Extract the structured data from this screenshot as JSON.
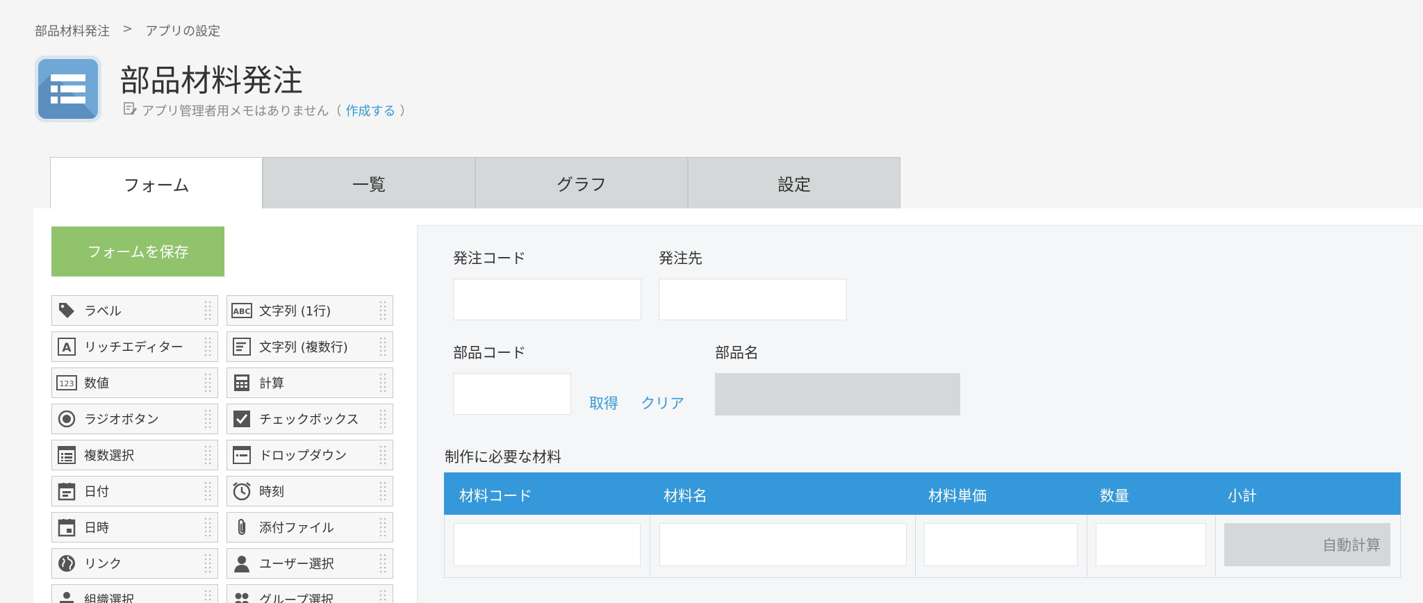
{
  "breadcrumb": {
    "app": "部品材料発注",
    "sep": ">",
    "current": "アプリの設定"
  },
  "app": {
    "title": "部品材料発注",
    "memo_text": "アプリ管理者用メモはありません（",
    "memo_link": "作成する",
    "memo_close": "）"
  },
  "tabs": [
    {
      "label": "フォーム",
      "active": true
    },
    {
      "label": "一覧"
    },
    {
      "label": "グラフ"
    },
    {
      "label": "設定"
    }
  ],
  "save_button": "フォームを保存",
  "palette": [
    {
      "label": "ラベル",
      "icon": "tag-icon"
    },
    {
      "label": "文字列 (1行)",
      "icon": "abc-text-icon"
    },
    {
      "label": "リッチエディター",
      "icon": "rich-editor-icon"
    },
    {
      "label": "文字列 (複数行)",
      "icon": "multiline-text-icon"
    },
    {
      "label": "数値",
      "icon": "number-icon"
    },
    {
      "label": "計算",
      "icon": "calculator-icon"
    },
    {
      "label": "ラジオボタン",
      "icon": "radio-icon"
    },
    {
      "label": "チェックボックス",
      "icon": "checkbox-icon"
    },
    {
      "label": "複数選択",
      "icon": "multi-select-icon"
    },
    {
      "label": "ドロップダウン",
      "icon": "dropdown-icon"
    },
    {
      "label": "日付",
      "icon": "date-icon"
    },
    {
      "label": "時刻",
      "icon": "clock-icon"
    },
    {
      "label": "日時",
      "icon": "datetime-icon"
    },
    {
      "label": "添付ファイル",
      "icon": "paperclip-icon"
    },
    {
      "label": "リンク",
      "icon": "globe-icon"
    },
    {
      "label": "ユーザー選択",
      "icon": "user-icon"
    },
    {
      "label": "組織選択",
      "icon": "organization-icon"
    },
    {
      "label": "グループ選択",
      "icon": "group-icon"
    }
  ],
  "form": {
    "order_code_label": "発注コード",
    "supplier_label": "発注先",
    "part_code_label": "部品コード",
    "fetch_link": "取得",
    "clear_link": "クリア",
    "part_name_label": "部品名",
    "table_title": "制作に必要な材料",
    "table_headers": [
      "材料コード",
      "材料名",
      "材料単価",
      "数量",
      "小計"
    ],
    "auto_calc": "自動計算"
  },
  "colors": {
    "accent": "#3498db",
    "save": "#91c36c",
    "tab_inactive": "#d5d8d9"
  }
}
